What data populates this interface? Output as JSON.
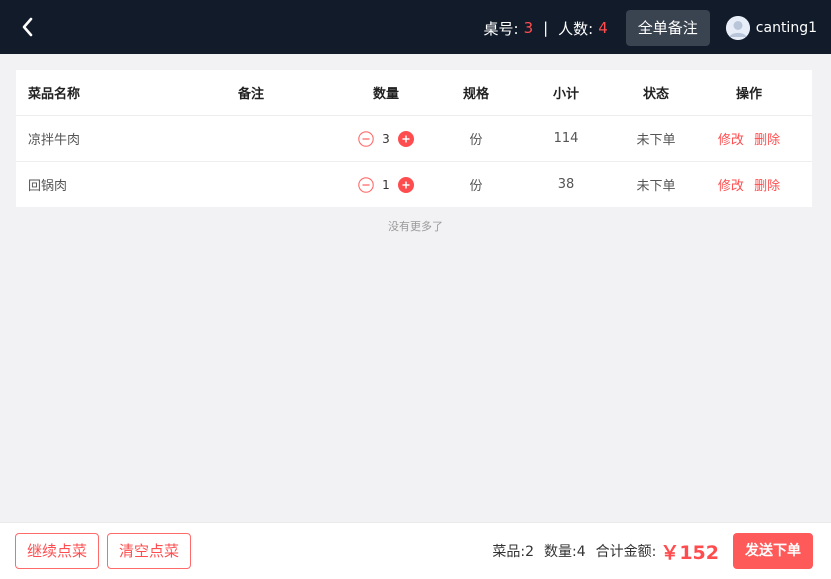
{
  "header": {
    "table_label": "桌号:",
    "table_no": "3",
    "separator": "|",
    "people_label": "人数:",
    "people_count": "4",
    "remark_button": "全单备注",
    "username": "canting1"
  },
  "table": {
    "columns": [
      "菜品名称",
      "备注",
      "数量",
      "规格",
      "小计",
      "状态",
      "操作"
    ],
    "rows": [
      {
        "name": "凉拌牛肉",
        "remark": "",
        "qty": "3",
        "spec": "份",
        "subtotal": "114",
        "status": "未下单",
        "edit": "修改",
        "delete": "删除"
      },
      {
        "name": "回锅肉",
        "remark": "",
        "qty": "1",
        "spec": "份",
        "subtotal": "38",
        "status": "未下单",
        "edit": "修改",
        "delete": "删除"
      }
    ],
    "no_more": "没有更多了"
  },
  "footer": {
    "continue_button": "继续点菜",
    "clear_button": "清空点菜",
    "dishes": "菜品:2",
    "quantity": "数量:4",
    "total_label": "合计金额:",
    "total_value": "￥152",
    "send_button": "发送下单"
  },
  "colors": {
    "header_bg": "#111b29",
    "accent": "#ff4d4f",
    "send_bg": "#ff5a5a"
  }
}
